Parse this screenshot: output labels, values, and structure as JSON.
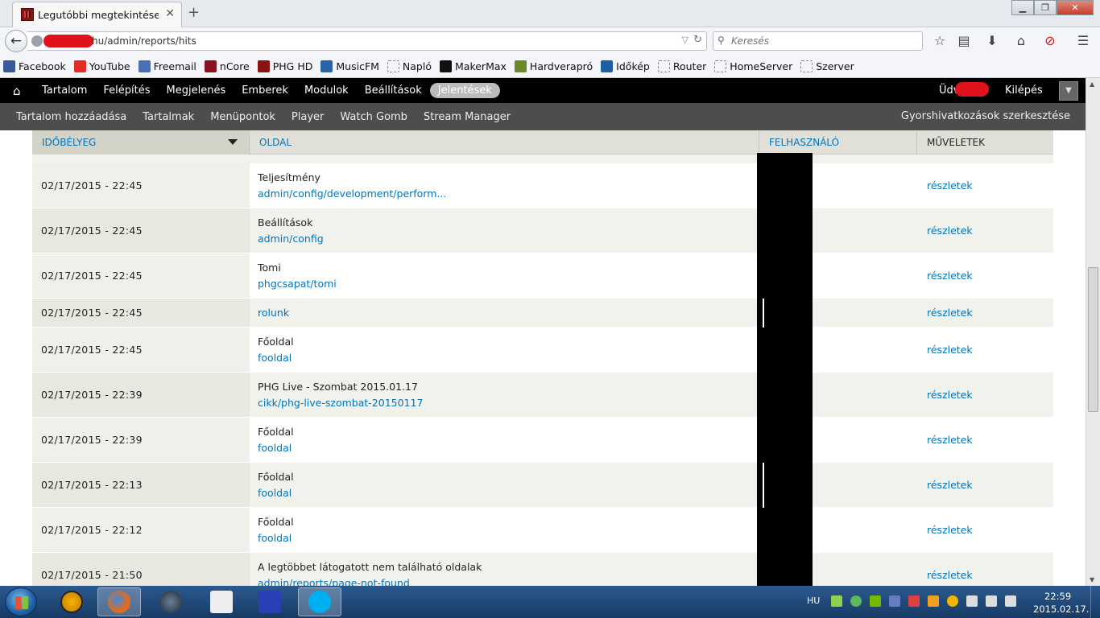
{
  "browser": {
    "tab_title": "Legutóbbi megtekintések | ...",
    "tab_close": "✕",
    "new_tab": "+",
    "url": "hu/admin/reports/hits",
    "search_placeholder": "Keresés",
    "win_min": "▁",
    "win_max": "❐",
    "win_close": "✕"
  },
  "bookmarks": [
    {
      "label": "Facebook",
      "color": "#3b5998"
    },
    {
      "label": "YouTube",
      "color": "#e52d27"
    },
    {
      "label": "Freemail",
      "color": "#4a6fb5"
    },
    {
      "label": "nCore",
      "color": "#8a1020"
    },
    {
      "label": "PHG HD",
      "color": "#8a1412"
    },
    {
      "label": "MusicFM",
      "color": "#2a63a8"
    },
    {
      "label": "Napló",
      "color": "#cccccc"
    },
    {
      "label": "MakerMax",
      "color": "#111111"
    },
    {
      "label": "Hardverapró",
      "color": "#6a8a2a"
    },
    {
      "label": "Időkép",
      "color": "#1d5fa4"
    },
    {
      "label": "Router",
      "color": "#cccccc"
    },
    {
      "label": "HomeServer",
      "color": "#cccccc"
    },
    {
      "label": "Szerver",
      "color": "#cccccc"
    }
  ],
  "toolbar": {
    "home_icon": "⌂",
    "menu": [
      "Tartalom",
      "Felépítés",
      "Megjelenés",
      "Emberek",
      "Modulok",
      "Beállítások",
      "Jelentések"
    ],
    "active_index": 6,
    "greeting": "Üdv",
    "greeting_suffix": "!",
    "logout": "Kilépés",
    "toggle": "▼"
  },
  "shortcuts": {
    "items": [
      "Tartalom hozzáadása",
      "Tartalmak",
      "Menüpontok",
      "Player",
      "Watch Gomb",
      "Stream Manager"
    ],
    "edit": "Gyorshivatkozások szerkesztése"
  },
  "table": {
    "headers": {
      "timestamp": "IDŐBÉLYEG",
      "page": "OLDAL",
      "user": "FELHASZNÁLÓ",
      "operations": "MŰVELETEK"
    },
    "rows": [
      {
        "timestamp": "02/17/2015 - 22:45",
        "title": "Teljesítmény",
        "path": "admin/config/development/perform...",
        "action": "részletek"
      },
      {
        "timestamp": "02/17/2015 - 22:45",
        "title": "Beállítások",
        "path": "admin/config",
        "action": "részletek"
      },
      {
        "timestamp": "02/17/2015 - 22:45",
        "title": "Tomi",
        "path": "phgcsapat/tomi",
        "action": "részletek"
      },
      {
        "timestamp": "02/17/2015 - 22:45",
        "title": "",
        "path": "rolunk",
        "action": "részletek"
      },
      {
        "timestamp": "02/17/2015 - 22:45",
        "title": "Főoldal",
        "path": "fooldal",
        "action": "részletek"
      },
      {
        "timestamp": "02/17/2015 - 22:39",
        "title": "PHG Live - Szombat 2015.01.17",
        "path": "cikk/phg-live-szombat-20150117",
        "action": "részletek"
      },
      {
        "timestamp": "02/17/2015 - 22:39",
        "title": "Főoldal",
        "path": "fooldal",
        "action": "részletek"
      },
      {
        "timestamp": "02/17/2015 - 22:13",
        "title": "Főoldal",
        "path": "fooldal",
        "action": "részletek"
      },
      {
        "timestamp": "02/17/2015 - 22:12",
        "title": "Főoldal",
        "path": "fooldal",
        "action": "részletek"
      },
      {
        "timestamp": "02/17/2015 - 21:50",
        "title": "A legtöbbet látogatott nem található oldalak",
        "path": "admin/reports/page-not-found",
        "action": "részletek"
      }
    ]
  },
  "taskbar": {
    "lang": "HU",
    "time": "22:59",
    "date": "2015.02.17."
  }
}
